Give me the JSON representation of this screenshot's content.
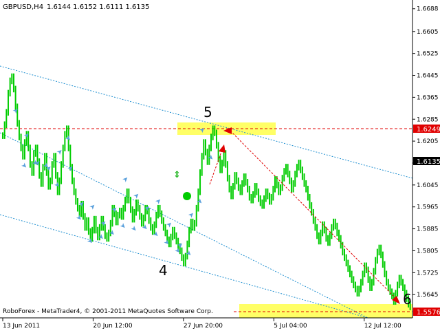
{
  "header": {
    "symbol": "GBPUSD,H4",
    "ohlc": "1.6144 1.6152 1.6111 1.6135"
  },
  "copyright": "RoboForex - MetaTrader4, © 2001-2011 MetaQuotes Software Corp.",
  "wave_labels": [
    "5",
    "4",
    "6"
  ],
  "colors": {
    "background": "#ffffff",
    "bars": "#00cc00",
    "channel": "#1f8fd0",
    "resistance": "#e00000",
    "forecast_arrow": "#e00000",
    "highlight_zone": "#ffff66",
    "price_tag": "#e00000",
    "current_tag": "#000000",
    "arrow_marker": "#5aa0dc",
    "signal_circle": "#00cc00"
  },
  "chart_data": {
    "type": "line",
    "instrument": "GBPUSD",
    "timeframe": "H4",
    "ylim": [
      1.556,
      1.672
    ],
    "yticks": [
      "1.6688",
      "1.6605",
      "1.6525",
      "1.6445",
      "1.6365",
      "1.6285",
      "1.6205",
      "1.6125",
      "1.6045",
      "1.5965",
      "1.5885",
      "1.5805",
      "1.5725",
      "1.5645"
    ],
    "xticks": [
      "13 Jun 2011",
      "20 Jun 12:00",
      "27 Jun 20:00",
      "5 Jul 04:00",
      "12 Jul 12:00"
    ],
    "xtick_index": [
      0,
      42,
      84,
      126,
      168
    ],
    "x_count": 390,
    "price_tags": {
      "resistance": "1.6249",
      "current": "1.6135",
      "target": "1.5576"
    },
    "resistance_level": 1.6249,
    "target_level": 1.5576,
    "close": [
      1.6225,
      1.6265,
      1.631,
      1.638,
      1.6425,
      1.644,
      1.6395,
      1.633,
      1.627,
      1.622,
      1.618,
      1.615,
      1.62,
      1.623,
      1.618,
      1.612,
      1.609,
      1.616,
      1.618,
      1.613,
      1.608,
      1.605,
      1.611,
      1.615,
      1.609,
      1.604,
      1.606,
      1.612,
      1.615,
      1.608,
      1.602,
      1.606,
      1.612,
      1.618,
      1.623,
      1.625,
      1.618,
      1.611,
      1.606,
      1.602,
      1.5985,
      1.596,
      1.594,
      1.5975,
      1.593,
      1.589,
      1.5915,
      1.5875,
      1.585,
      1.588,
      1.592,
      1.588,
      1.5855,
      1.589,
      1.592,
      1.589,
      1.586,
      1.585,
      1.587,
      1.5905,
      1.596,
      1.594,
      1.591,
      1.5935,
      1.595,
      1.593,
      1.596,
      1.599,
      1.602,
      1.599,
      1.5955,
      1.592,
      1.5945,
      1.598,
      1.596,
      1.593,
      1.5905,
      1.5925,
      1.596,
      1.595,
      1.5915,
      1.589,
      1.5875,
      1.59,
      1.5935,
      1.596,
      1.594,
      1.5915,
      1.589,
      1.587,
      1.5845,
      1.583,
      1.5855,
      1.588,
      1.586,
      1.584,
      1.582,
      1.5805,
      1.578,
      1.576,
      1.5785,
      1.583,
      1.588,
      1.591,
      1.589,
      1.5905,
      1.596,
      1.602,
      1.609,
      1.615,
      1.62,
      1.6165,
      1.613,
      1.618,
      1.622,
      1.625,
      1.6235,
      1.619,
      1.614,
      1.61,
      1.6125,
      1.616,
      1.612,
      1.607,
      1.603,
      1.6005,
      1.604,
      1.608,
      1.606,
      1.6035,
      1.602,
      1.605,
      1.6075,
      1.6055,
      1.603,
      1.6,
      1.599,
      1.601,
      1.604,
      1.602,
      1.5995,
      1.598,
      1.597,
      1.5995,
      1.602,
      1.6005,
      1.5985,
      1.6,
      1.603,
      1.6065,
      1.6045,
      1.602,
      1.6035,
      1.607,
      1.6095,
      1.611,
      1.6085,
      1.606,
      1.603,
      1.605,
      1.6085,
      1.611,
      1.6125,
      1.61,
      1.6075,
      1.605,
      1.603,
      1.6,
      1.597,
      1.5945,
      1.5915,
      1.589,
      1.586,
      1.584,
      1.587,
      1.59,
      1.588,
      1.585,
      1.5835,
      1.586,
      1.589,
      1.591,
      1.5895,
      1.587,
      1.585,
      1.5825,
      1.58,
      1.578,
      1.576,
      1.574,
      1.572,
      1.57,
      1.568,
      1.5665,
      1.565,
      1.5665,
      1.569,
      1.572,
      1.575,
      1.5735,
      1.57,
      1.567,
      1.569,
      1.573,
      1.577,
      1.58,
      1.5815,
      1.579,
      1.5755,
      1.572,
      1.569,
      1.567,
      1.5655,
      1.564,
      1.562,
      1.565,
      1.568,
      1.5705,
      1.569,
      1.567,
      1.565,
      1.563,
      1.561,
      1.56
    ]
  }
}
